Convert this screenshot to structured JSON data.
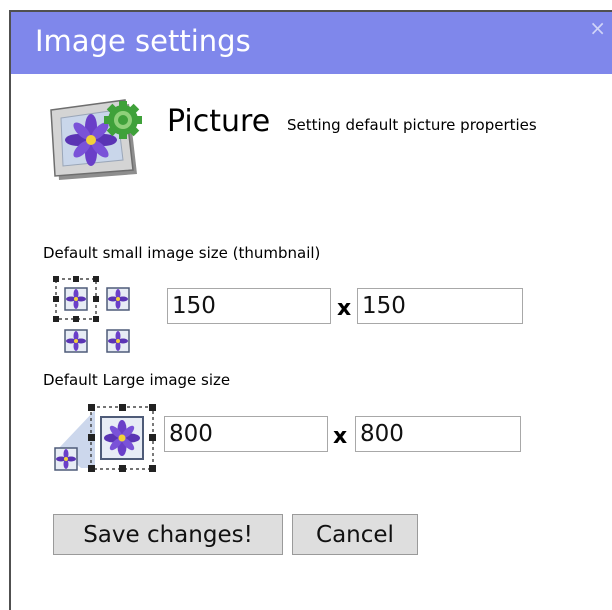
{
  "dialog": {
    "title": "Image settings",
    "close_glyph": "×"
  },
  "header": {
    "icon": "picture-settings-icon",
    "title": "Picture",
    "subtitle": "Setting default picture properties"
  },
  "small_image": {
    "label": "Default small image size (thumbnail)",
    "icon": "thumbnail-size-icon",
    "width": "150",
    "separator": "x",
    "height": "150"
  },
  "large_image": {
    "label": "Default Large image size",
    "icon": "large-image-size-icon",
    "width": "800",
    "separator": "x",
    "height": "800"
  },
  "buttons": {
    "save": "Save changes!",
    "cancel": "Cancel"
  },
  "colors": {
    "titlebar": "#7f87eb",
    "flower": "#6a3fc8",
    "gear": "#3fa13a"
  }
}
